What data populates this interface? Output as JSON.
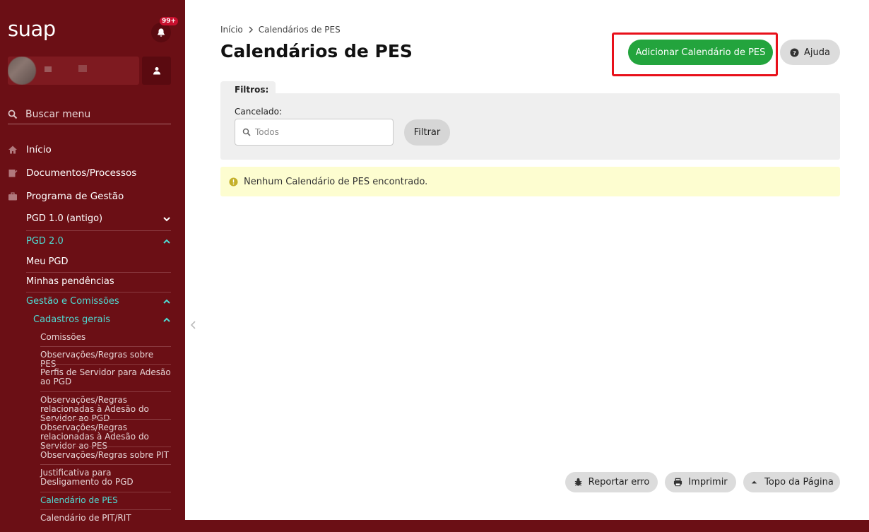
{
  "brand": {
    "logo": "suap",
    "notifications_badge": "99+"
  },
  "sidebar": {
    "search_placeholder": "Buscar menu",
    "top_items": [
      {
        "label": "Início",
        "icon": "home-icon"
      },
      {
        "label": "Documentos/Processos",
        "icon": "documents-icon"
      },
      {
        "label": "Programa de Gestão",
        "icon": "briefcase-icon"
      }
    ],
    "groups": [
      {
        "label": "PGD 1.0 (antigo)",
        "expanded": false
      },
      {
        "label": "PGD 2.0",
        "expanded": true
      },
      {
        "label": "Meu PGD"
      },
      {
        "label": "Minhas pendências"
      },
      {
        "label": "Gestão e Comissões",
        "expanded": true
      },
      {
        "label": "Cadastros gerais",
        "expanded": true
      }
    ],
    "leaves": [
      {
        "label": "Comissões"
      },
      {
        "label": "Observações/Regras sobre PES"
      },
      {
        "label": "Perfis de Servidor para Adesão ao PGD"
      },
      {
        "label": "Observações/Regras relacionadas à Adesão do Servidor ao PGD"
      },
      {
        "label": "Observações/Regras relacionadas à Adesão do Servidor ao PES"
      },
      {
        "label": "Observações/Regras sobre PIT"
      },
      {
        "label": "Justificativa para Desligamento do PGD"
      },
      {
        "label": "Calendário de PES",
        "active": true
      },
      {
        "label": "Calendário de PIT/RIT"
      }
    ]
  },
  "breadcrumb": {
    "home": "Início",
    "current": "Calendários de PES"
  },
  "page": {
    "title": "Calendários de PES",
    "add_button": "Adicionar Calendário de PES",
    "help_button": "Ajuda"
  },
  "filters": {
    "tab_label": "Filtros:",
    "field_label": "Cancelado:",
    "field_value": "Todos",
    "submit_label": "Filtrar"
  },
  "alert": {
    "message": "Nenhum Calendário de PES encontrado."
  },
  "footer": {
    "report_error": "Reportar erro",
    "print": "Imprimir",
    "top": "Topo da Página"
  },
  "colors": {
    "sidebar_bg": "#6b0f15",
    "accent_green": "#23a43d",
    "active_link": "#4fdcd4",
    "highlight_border": "#e8101a",
    "alert_bg": "#fdfdd0"
  }
}
